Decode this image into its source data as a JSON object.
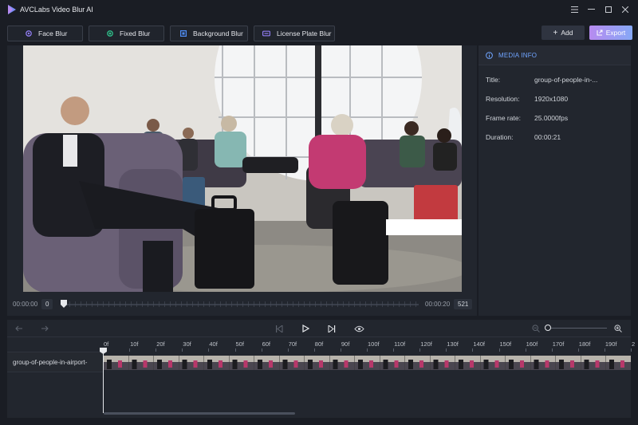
{
  "app": {
    "title": "AVCLabs Video Blur AI"
  },
  "window_controls": [
    "menu-icon",
    "minimize-icon",
    "maximize-icon",
    "close-icon"
  ],
  "toolbar": {
    "face_blur": "Face Blur",
    "fixed_blur": "Fixed Blur",
    "background_blur": "Background Blur",
    "license_plate_blur": "License Plate Blur",
    "add": "Add",
    "export": "Export"
  },
  "preview": {
    "time_start": "00:00:00",
    "frame_start": "0",
    "time_end": "00:00:20",
    "frame_end": "521"
  },
  "media_info": {
    "header": "MEDIA INFO",
    "rows": [
      {
        "label": "Title:",
        "value": "group-of-people-in-..."
      },
      {
        "label": "Resolution:",
        "value": "1920x1080"
      },
      {
        "label": "Frame rate:",
        "value": "25.0000fps"
      },
      {
        "label": "Duration:",
        "value": "00:00:21"
      }
    ]
  },
  "timeline": {
    "ruler": [
      "0f",
      "10f",
      "20f",
      "30f",
      "40f",
      "50f",
      "60f",
      "70f",
      "80f",
      "90f",
      "100f",
      "110f",
      "120f",
      "130f",
      "140f",
      "150f",
      "160f",
      "170f",
      "180f",
      "190f",
      "2"
    ],
    "track_name": "group-of-people-in-airport-"
  },
  "colors": {
    "accent": "#6fa4ff",
    "export_gradient_start": "#b78bf0",
    "export_gradient_end": "#86a8f6",
    "background": "#1a1d24",
    "panel": "#22262e"
  }
}
